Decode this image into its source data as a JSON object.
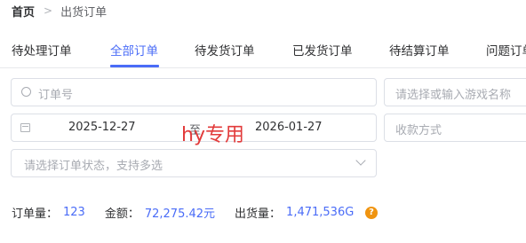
{
  "breadcrumb": {
    "home": "首页",
    "separator": ">",
    "current": "出货订单"
  },
  "tabs": [
    {
      "label": "待处理订单"
    },
    {
      "label": "全部订单",
      "active": true
    },
    {
      "label": "待发货订单"
    },
    {
      "label": "已发货订单"
    },
    {
      "label": "待结算订单"
    },
    {
      "label": "问题订单"
    }
  ],
  "filters": {
    "order_no_placeholder": "订单号",
    "game_placeholder": "请选择或输入游戏名称",
    "date_start": "2025-12-27",
    "date_separator": "至",
    "date_end": "2026-01-27",
    "payment_placeholder": "收款方式",
    "status_placeholder": "请选择订单状态，支持多选"
  },
  "watermark": "hy专用",
  "summary": {
    "count_label": "订单量：",
    "count_value": "123",
    "amount_label": "金额：",
    "amount_value": "72,275.42元",
    "volume_label": "出货量：",
    "volume_value": "1,471,536G"
  },
  "colors": {
    "accent": "#4a6cf7",
    "watermark": "#e23b3b",
    "help": "#f0940f"
  },
  "icons": {
    "help": "?"
  }
}
